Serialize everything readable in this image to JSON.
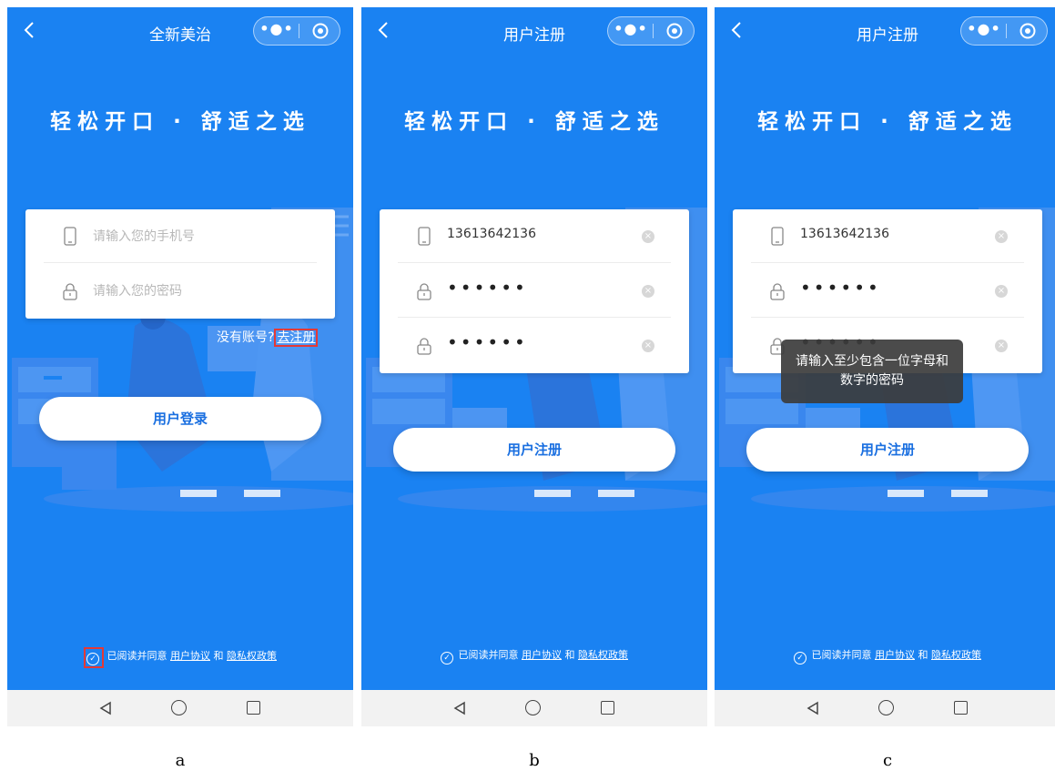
{
  "screens": [
    {
      "nav_title": "全新美治",
      "slogan": "轻松开口 · 舒适之选",
      "phone_placeholder": "请输入您的手机号",
      "password_placeholder": "请输入您的密码",
      "no_account_text": "没有账号?",
      "register_link": "去注册",
      "button_label": "用户登录",
      "agree_text": "已阅读并同意",
      "user_agreement": "用户协议",
      "and_text": "和",
      "privacy_policy": "隐私权政策",
      "caption": "a"
    },
    {
      "nav_title": "用户注册",
      "slogan": "轻松开口 · 舒适之选",
      "phone_value": "13613642136",
      "password_mask": "••••••",
      "confirm_mask": "••••••",
      "button_label": "用户注册",
      "agree_text": "已阅读并同意",
      "user_agreement": "用户协议",
      "and_text": "和",
      "privacy_policy": "隐私权政策",
      "caption": "b"
    },
    {
      "nav_title": "用户注册",
      "slogan": "轻松开口 · 舒适之选",
      "phone_value": "13613642136",
      "password_mask": "••••••",
      "confirm_mask": "••••••",
      "toast_line1": "请输入至少包含一位字母和",
      "toast_line2": "数字的密码",
      "button_label": "用户注册",
      "agree_text": "已阅读并同意",
      "user_agreement": "用户协议",
      "and_text": "和",
      "privacy_policy": "隐私权政策",
      "caption": "c"
    }
  ],
  "icons": {
    "back": "back-chevron-icon",
    "more": "more-dots-icon",
    "close_miniapp": "target-circle-icon",
    "phone": "mobile-phone-icon",
    "lock": "lock-icon",
    "clear": "clear-x-icon",
    "check": "check-circle-icon",
    "sys_back": "triangle-back-icon",
    "sys_home": "circle-home-icon",
    "sys_recent": "square-recent-icon"
  },
  "colors": {
    "background_blue": "#1a82f2",
    "button_text": "#1a6fe0",
    "highlight_red": "#e53935"
  }
}
